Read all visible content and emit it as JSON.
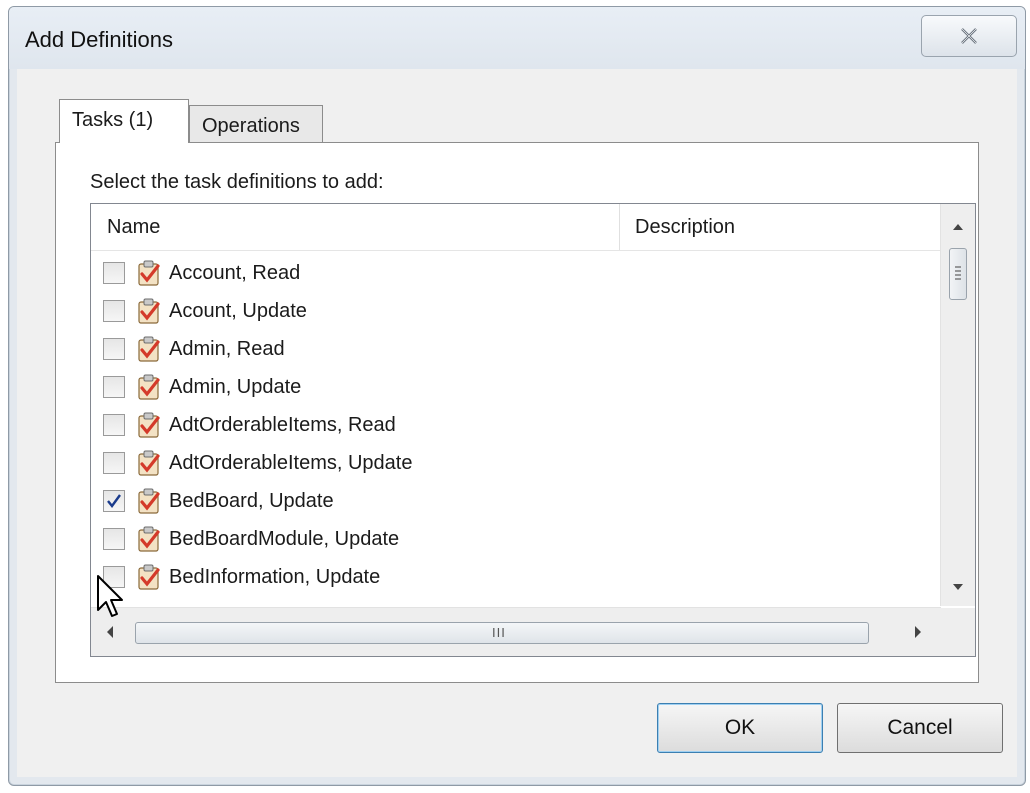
{
  "dialog": {
    "title": "Add Definitions"
  },
  "tabs": [
    {
      "label": "Tasks (1)",
      "selected": true
    },
    {
      "label": "Operations",
      "selected": false
    }
  ],
  "panel": {
    "prompt": "Select the task definitions to add:"
  },
  "list": {
    "columns": {
      "name": "Name",
      "description": "Description"
    },
    "rows": [
      {
        "label": "Account, Read",
        "checked": false
      },
      {
        "label": "Acount, Update",
        "checked": false
      },
      {
        "label": "Admin, Read",
        "checked": false
      },
      {
        "label": "Admin, Update",
        "checked": false
      },
      {
        "label": "AdtOrderableItems, Read",
        "checked": false
      },
      {
        "label": "AdtOrderableItems, Update",
        "checked": false
      },
      {
        "label": "BedBoard, Update",
        "checked": true
      },
      {
        "label": "BedBoardModule, Update",
        "checked": false
      },
      {
        "label": "BedInformation, Update",
        "checked": false
      }
    ],
    "row_icon": "task-clipboard-icon"
  },
  "buttons": {
    "ok": "OK",
    "cancel": "Cancel"
  },
  "colors": {
    "dialog_frame": "#e3e8ee",
    "client": "#f0f0f0",
    "default_button_border": "#3c7fb1",
    "check_mark": "#1a3b8c",
    "task_icon_red": "#d43a2a"
  }
}
